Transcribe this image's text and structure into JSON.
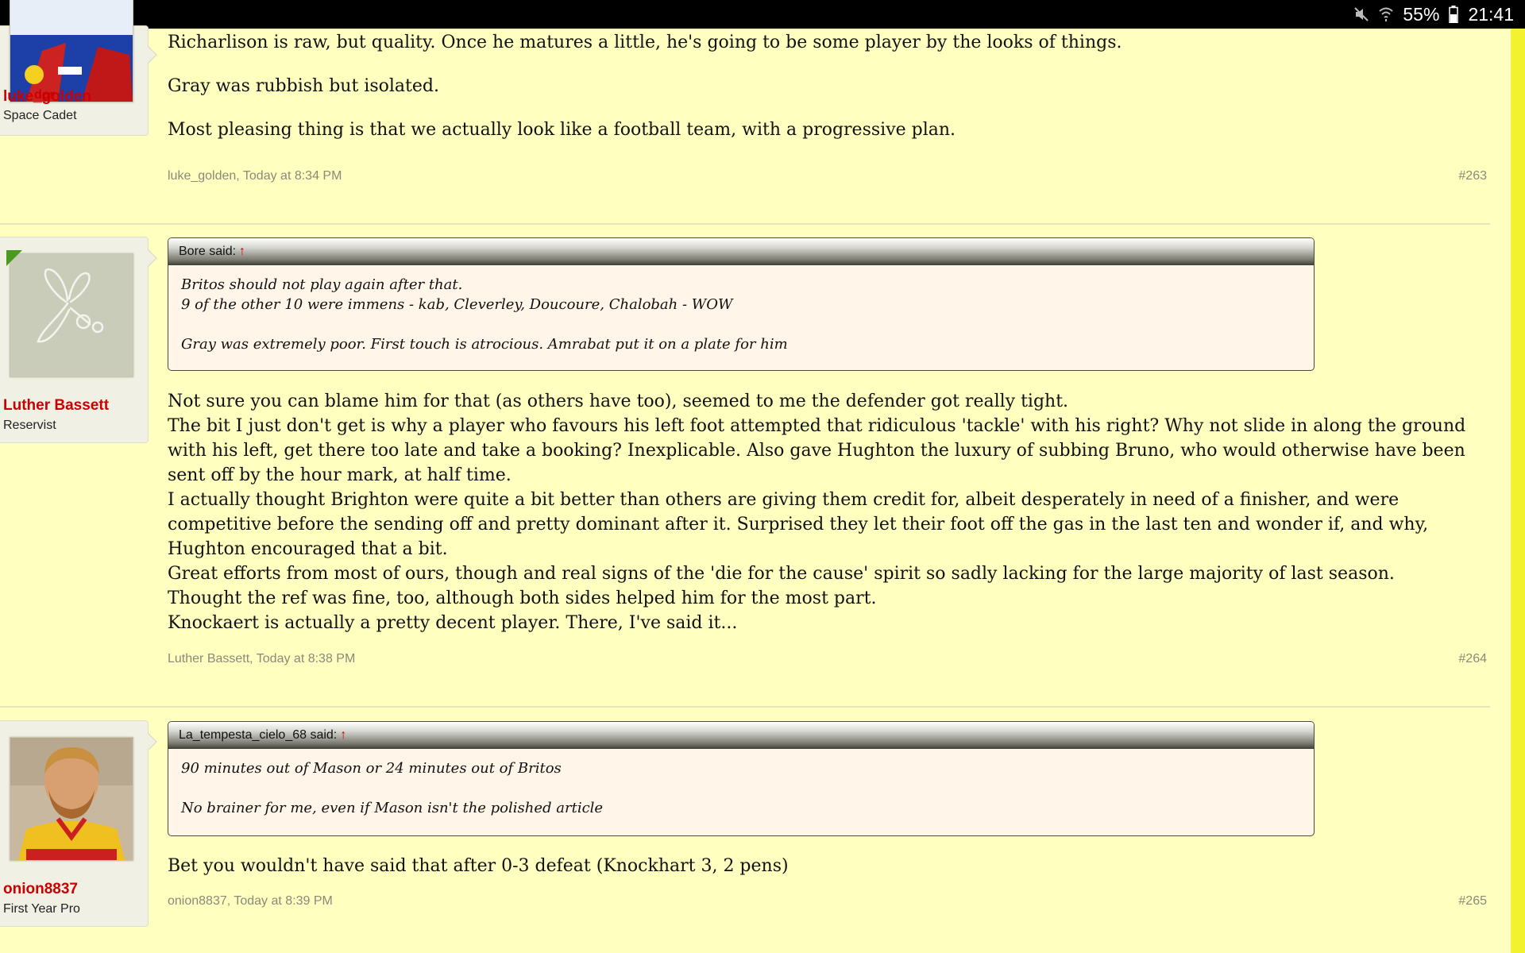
{
  "status_bar": {
    "battery_percent": "55%",
    "time": "21:41",
    "icons": [
      "malwarebytes-icon",
      "mute-icon",
      "wifi-icon",
      "battery-icon"
    ]
  },
  "posts": [
    {
      "username": "luke_golden",
      "user_title": "Space Cadet",
      "paragraphs": [
        "Richarlison is raw, but quality. Once he matures a little, he's going to be some player by the looks of things.",
        "",
        "Gray was rubbish but isolated.",
        "",
        "Most pleasing thing is that we actually look like a football team, with a progressive plan."
      ],
      "meta": "luke_golden, Today at 8:34 PM",
      "post_number": "#263"
    },
    {
      "username": "Luther Bassett",
      "user_title": "Reservist",
      "quote": {
        "author": "Bore said:",
        "arrow": "↑",
        "lines": [
          "Britos should not play again after that.",
          "9 of the other 10 were immens - kab, Cleverley, Doucoure, Chalobah - WOW",
          "",
          "Gray was extremely poor. First touch is atrocious. Amrabat put it on a plate for him"
        ]
      },
      "paragraphs": [
        "Not sure you can blame him for that (as others have too), seemed to me the defender got really tight.",
        "The bit I just don't get is why a player who favours his left foot attempted that ridiculous 'tackle' with his right? Why not slide in along the ground with his left, get there too late and take a booking? Inexplicable. Also gave Hughton the luxury of subbing Bruno, who would otherwise have been sent off by the hour mark, at half time.",
        "I actually thought Brighton were quite a bit better than others are giving them credit for, albeit desperately in need of a finisher, and were competitive before the sending off and pretty dominant after it. Surprised they let their foot off the gas in the last ten and wonder if, and why, Hughton encouraged that a bit.",
        "Great efforts from most of ours, though and real signs of the 'die for the cause' spirit so sadly lacking for the large majority of last season.",
        "Thought the ref was fine, too, although both sides helped him for the most part.",
        "Knockaert is actually a pretty decent player. There, I've said it..."
      ],
      "meta": "Luther Bassett, Today at 8:38 PM",
      "post_number": "#264"
    },
    {
      "username": "onion8837",
      "user_title": "First Year Pro",
      "quote": {
        "author": "La_tempesta_cielo_68 said:",
        "arrow": "↑",
        "lines": [
          "90 minutes out of Mason or 24 minutes out of Britos",
          "",
          "No brainer for me, even if Mason isn't the polished article"
        ]
      },
      "paragraphs": [
        "Bet you wouldn't have said that after 0-3 defeat (Knockhart 3, 2 pens)"
      ],
      "meta": "onion8837, Today at 8:39 PM",
      "post_number": "#265"
    }
  ]
}
